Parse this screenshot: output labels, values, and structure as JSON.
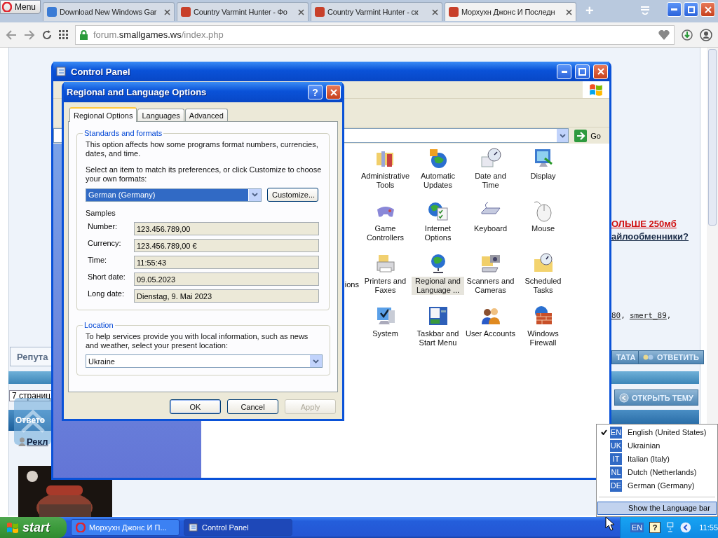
{
  "browser": {
    "menu_button": "Menu",
    "tabs": [
      {
        "title": "Download New Windows Gar",
        "selected": false
      },
      {
        "title": "Country Varmint Hunter - Фо",
        "selected": false
      },
      {
        "title": "Country Varmint Hunter - ск",
        "selected": false
      },
      {
        "title": "Морхухн Джонс И Последн",
        "selected": true
      }
    ],
    "new_tab": "+",
    "url_prefix": "forum.",
    "url_domain": "smallgames.ws",
    "url_path": "/index.php"
  },
  "webpage": {
    "reputation_button": "Репута",
    "pages": "7 страниц",
    "answers_bar": "Ответо",
    "ads_link": "Рекл",
    "red_link": "ОЛЬШЕ 250мб",
    "question_link": "айлообменники?",
    "users": [
      "80",
      "smert_89"
    ],
    "separator": ",",
    "post_buttons": [
      "ТАТА",
      "ОТВЕТИТЬ"
    ],
    "open_topic_button": "ОТКРЫТЬ ТЕМУ"
  },
  "control_panel": {
    "title": "Control Panel",
    "go_button": "Go",
    "fragment": "ions",
    "items": [
      {
        "label": "Administrative Tools",
        "selected": false
      },
      {
        "label": "Automatic Updates",
        "selected": false
      },
      {
        "label": "Date and Time",
        "selected": false
      },
      {
        "label": "Display",
        "selected": false
      },
      {
        "label": "Game Controllers",
        "selected": false
      },
      {
        "label": "Internet Options",
        "selected": false
      },
      {
        "label": "Keyboard",
        "selected": false
      },
      {
        "label": "Mouse",
        "selected": false
      },
      {
        "label": "Printers and Faxes",
        "selected": false
      },
      {
        "label": "Regional and Language ...",
        "selected": true
      },
      {
        "label": "Scanners and Cameras",
        "selected": false
      },
      {
        "label": "Scheduled Tasks",
        "selected": false
      },
      {
        "label": "System",
        "selected": false
      },
      {
        "label": "Taskbar and Start Menu",
        "selected": false
      },
      {
        "label": "User Accounts",
        "selected": false
      },
      {
        "label": "Windows Firewall",
        "selected": false
      }
    ]
  },
  "dialog": {
    "title": "Regional and Language Options",
    "help_button": "?",
    "tabs": [
      {
        "label": "Regional Options",
        "selected": true
      },
      {
        "label": "Languages",
        "selected": false
      },
      {
        "label": "Advanced",
        "selected": false
      }
    ],
    "standards": {
      "legend": "Standards and formats",
      "description": "This option affects how some programs format numbers, currencies, dates, and time.",
      "prompt": "Select an item to match its preferences, or click Customize to choose your own formats:",
      "format": "German (Germany)",
      "customize_button": "Customize...",
      "samples_label": "Samples",
      "samples": [
        {
          "label": "Number:",
          "value": "123.456.789,00"
        },
        {
          "label": "Currency:",
          "value": "123.456.789,00 €"
        },
        {
          "label": "Time:",
          "value": "11:55:43"
        },
        {
          "label": "Short date:",
          "value": "09.05.2023"
        },
        {
          "label": "Long date:",
          "value": "Dienstag, 9. Mai 2023"
        }
      ]
    },
    "location": {
      "legend": "Location",
      "description": "To help services provide you with local information, such as news and weather, select your present location:",
      "value": "Ukraine"
    },
    "buttons": [
      {
        "label": "OK",
        "disabled": false
      },
      {
        "label": "Cancel",
        "disabled": false
      },
      {
        "label": "Apply",
        "disabled": true
      }
    ]
  },
  "language_menu": {
    "languages": [
      {
        "code": "EN",
        "name": "English (United States)",
        "checked": true
      },
      {
        "code": "UK",
        "name": "Ukrainian",
        "checked": false
      },
      {
        "code": "IT",
        "name": "Italian (Italy)",
        "checked": false
      },
      {
        "code": "NL",
        "name": "Dutch (Netherlands)",
        "checked": false
      },
      {
        "code": "DE",
        "name": "German (Germany)",
        "checked": false
      }
    ],
    "show_bar": {
      "label": "Show the Language bar",
      "selected": true
    }
  },
  "taskbar": {
    "start": "start",
    "tasks": [
      {
        "label": "Морхухн Джонс И П...",
        "selected": false
      },
      {
        "label": "Control Panel",
        "selected": true
      }
    ],
    "language": "EN",
    "help": "?",
    "clock": "11:55"
  }
}
